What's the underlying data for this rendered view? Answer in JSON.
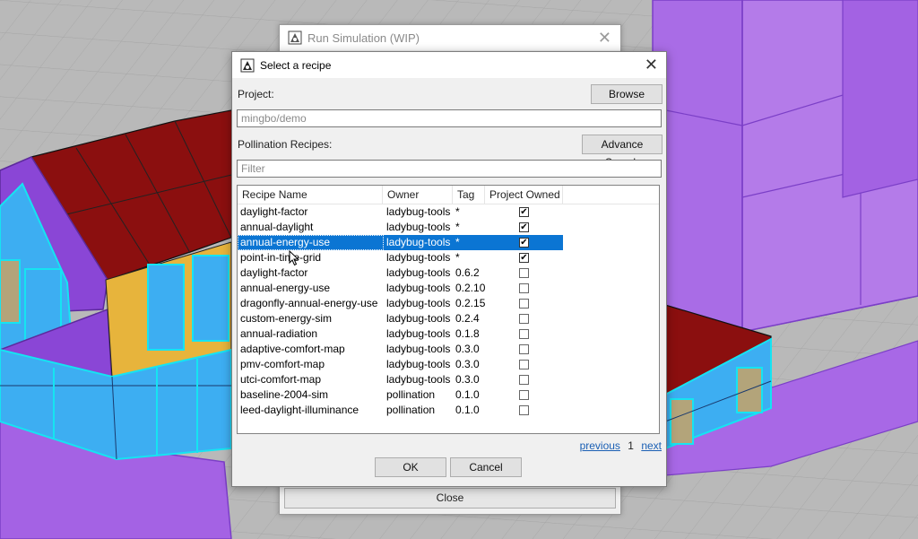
{
  "back_dialog": {
    "title": "Run Simulation (WIP)",
    "close_label": "Close"
  },
  "dialog": {
    "title": "Select a recipe",
    "project_label": "Project:",
    "browse_label": "Browse",
    "project_placeholder": "mingbo/demo",
    "recipes_label": "Pollination Recipes:",
    "advance_search_label": "Advance Search",
    "filter_placeholder": "Filter",
    "columns": [
      "Recipe Name",
      "Owner",
      "Tag",
      "Project Owned"
    ],
    "rows": [
      {
        "name": "daylight-factor",
        "owner": "ladybug-tools",
        "tag": "*",
        "owned": true
      },
      {
        "name": "annual-daylight",
        "owner": "ladybug-tools",
        "tag": "*",
        "owned": true
      },
      {
        "name": "annual-energy-use",
        "owner": "ladybug-tools",
        "tag": "*",
        "owned": true,
        "selected": true
      },
      {
        "name": "point-in-time-grid",
        "owner": "ladybug-tools",
        "tag": "*",
        "owned": true
      },
      {
        "name": "daylight-factor",
        "owner": "ladybug-tools",
        "tag": "0.6.2",
        "owned": false
      },
      {
        "name": "annual-energy-use",
        "owner": "ladybug-tools",
        "tag": "0.2.10",
        "owned": false
      },
      {
        "name": "dragonfly-annual-energy-use",
        "owner": "ladybug-tools",
        "tag": "0.2.15",
        "owned": false
      },
      {
        "name": "custom-energy-sim",
        "owner": "ladybug-tools",
        "tag": "0.2.4",
        "owned": false
      },
      {
        "name": "annual-radiation",
        "owner": "ladybug-tools",
        "tag": "0.1.8",
        "owned": false
      },
      {
        "name": "adaptive-comfort-map",
        "owner": "ladybug-tools",
        "tag": "0.3.0",
        "owned": false
      },
      {
        "name": "pmv-comfort-map",
        "owner": "ladybug-tools",
        "tag": "0.3.0",
        "owned": false
      },
      {
        "name": "utci-comfort-map",
        "owner": "ladybug-tools",
        "tag": "0.3.0",
        "owned": false
      },
      {
        "name": "baseline-2004-sim",
        "owner": "pollination",
        "tag": "0.1.0",
        "owned": false
      },
      {
        "name": "leed-daylight-illuminance",
        "owner": "pollination",
        "tag": "0.1.0",
        "owned": false
      }
    ],
    "pager": {
      "previous": "previous",
      "page": "1",
      "next": "next"
    },
    "ok_label": "OK",
    "cancel_label": "Cancel"
  },
  "colors": {
    "selection": "#0b75d3",
    "roof": "#8b0f0f",
    "walls": "#9a55e0",
    "glass": "#39aef2",
    "opaque": "#e7b43c",
    "ground": "#b9b9b9"
  }
}
